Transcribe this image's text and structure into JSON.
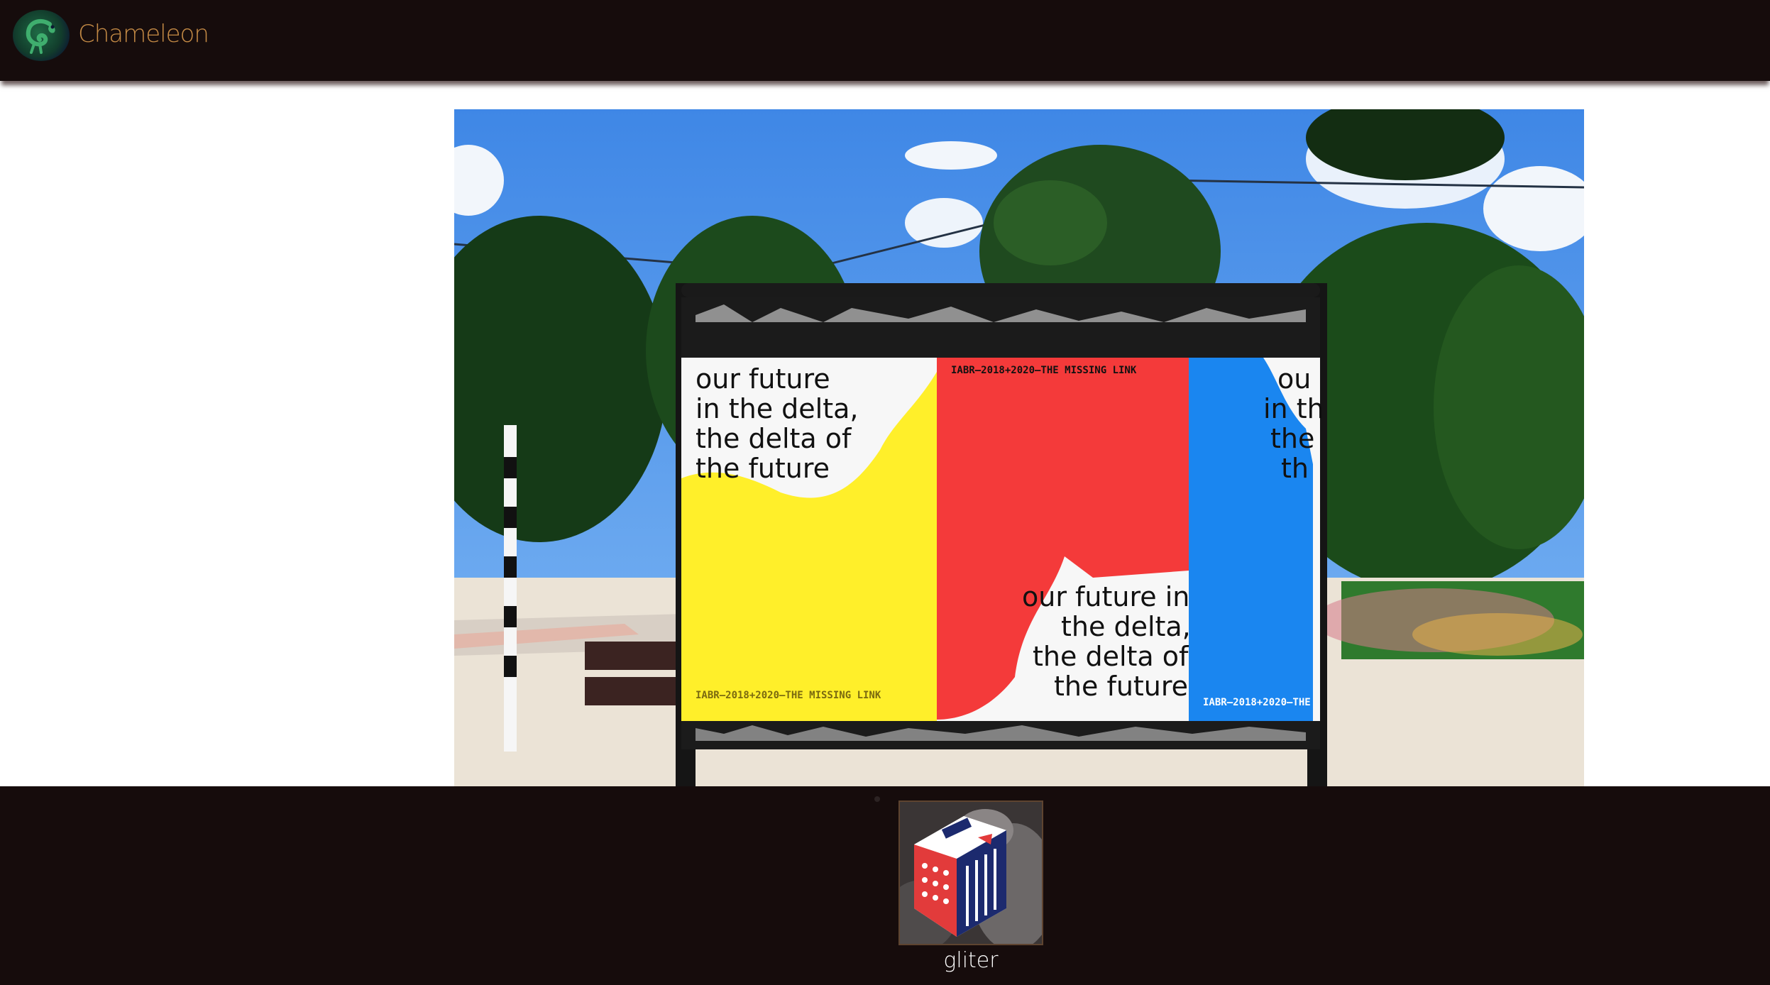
{
  "app": {
    "brand_name": "Chameleon",
    "brand_color": "#c48a45",
    "logo_icon": "chameleon-logo-icon"
  },
  "photo": {
    "poster_text_1": [
      "our future",
      "in the delta,",
      "the delta of",
      "the future"
    ],
    "poster_text_2": [
      "our future in",
      "the delta,",
      "the delta of",
      "the future"
    ],
    "poster_header_red": "IABR–2018+2020–THE MISSING LINK",
    "poster_footer_yellow": "IABR–2018+2020–THE MISSING LINK",
    "poster_footer_blue": "IABR–2018+2020–THE",
    "poster_text_blue": [
      "ou",
      "in th",
      "the",
      "th"
    ]
  },
  "gallery": {
    "items": [
      {
        "label": "gliter"
      }
    ]
  },
  "colors": {
    "header_bg": "#160c0c",
    "poster_yellow": "#ffef2a",
    "poster_red": "#f43a3a",
    "poster_blue": "#1a86f0"
  }
}
